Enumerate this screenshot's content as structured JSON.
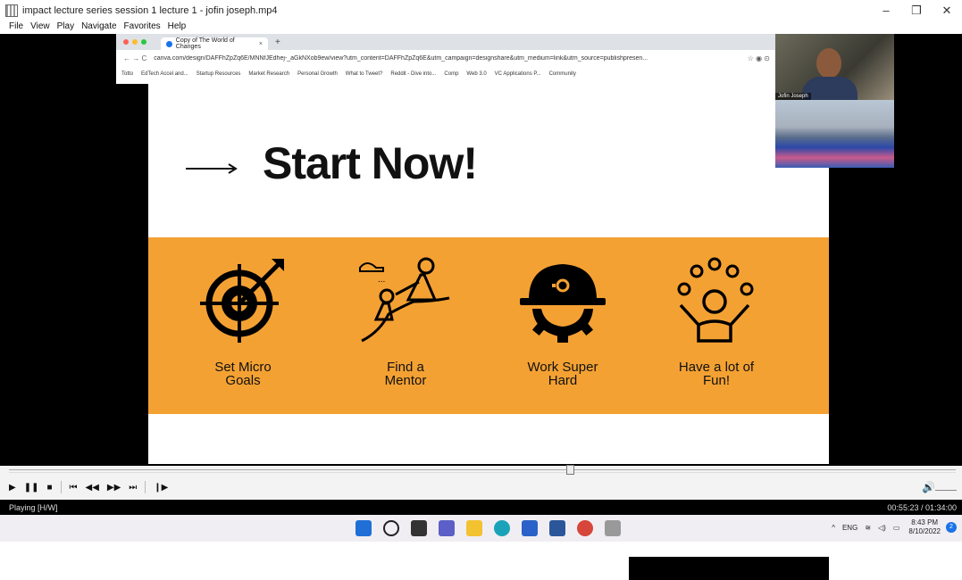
{
  "window": {
    "title": "impact lecture series session 1 lecture 1 - jofin joseph.mp4",
    "minimize": "–",
    "maximize": "❐",
    "close": "✕"
  },
  "menu": [
    "File",
    "View",
    "Play",
    "Navigate",
    "Favorites",
    "Help"
  ],
  "browser": {
    "tab_title": "Copy of The World of Changes",
    "tab_close": "×",
    "new_tab": "+",
    "nav": "← → C",
    "url": "canva.com/design/DAFFhZpZq6E/MNNfJEdhej-_aGkNXob9ew/view?utm_content=DAFFhZpZq6E&utm_campaign=designshare&utm_medium=link&utm_source=publishpresen...",
    "bookmarks": [
      "Totto",
      "EdTech Accel and...",
      "Startup Resources",
      "Market Research",
      "Personal Growth",
      "What to Tweet?",
      "Reddit - Dive into...",
      "Comp",
      "Web 3.0",
      "VC Applications P...",
      "Community"
    ]
  },
  "slide": {
    "title": "Start Now!",
    "items": [
      {
        "label1": "Set Micro",
        "label2": "Goals",
        "icon": "target-icon"
      },
      {
        "label1": "Find a",
        "label2": "Mentor",
        "icon": "climbing-help-icon"
      },
      {
        "label1": "Work Super",
        "label2": "Hard",
        "icon": "helmet-gear-icon"
      },
      {
        "label1": "Have a lot of",
        "label2": "Fun!",
        "icon": "juggling-person-icon"
      }
    ]
  },
  "webcam": {
    "name": "Jofin Joseph"
  },
  "player": {
    "buttons": [
      "▶",
      "❚❚",
      "■",
      "⏮",
      "◀◀",
      "▶▶",
      "⏭",
      "❙▶"
    ],
    "volume_icon": "🔊",
    "status": "Playing [H/W]",
    "time": "00:55:23 / 01:34:00",
    "progress_fraction": 0.589
  },
  "taskbar": {
    "tray_up": "^",
    "lang": "ENG",
    "clock_time": "8:43 PM",
    "clock_date": "8/10/2022",
    "notif": "2"
  }
}
